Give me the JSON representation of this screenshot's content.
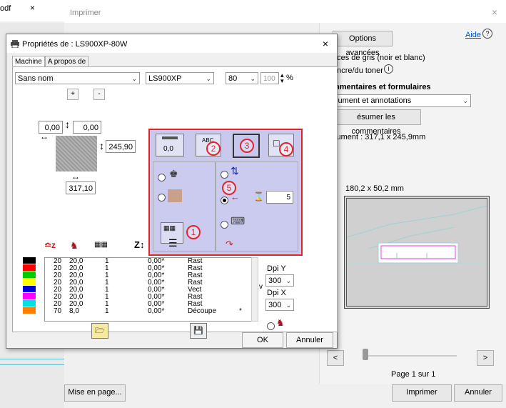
{
  "bg_dialog": {
    "tab_label": "odf",
    "tab_close": "×",
    "title": "Imprimer",
    "close": "×",
    "options_button": "Options avancées",
    "help_link": "Aide",
    "help_icon": "?",
    "grayscale_text": "nces de gris (noir et blanc)",
    "ink_text": "encre/du toner",
    "info_icon": "i",
    "comments_heading": "mmentaires et formulaires",
    "comments_select": "cument et annotations",
    "summarize_button": "ésumer les commentaires",
    "document_size": "cument : 317,1 x 245,9mm",
    "preview_size": "180,2 x 50,2 mm",
    "prev_button": "<",
    "next_button": ">",
    "page_label": "Page 1 sur 1",
    "layout_button": "Mise en page...",
    "print_button": "Imprimer",
    "cancel_button": "Annuler"
  },
  "props_dialog": {
    "title": "Propriétés de : LS900XP-80W",
    "close": "×",
    "tabs": [
      "Machine",
      "A propos de"
    ],
    "profile_select": "Sans nom",
    "model_select": "LS900XP",
    "power_select": "80",
    "percent_value": "100",
    "percent_unit": "%",
    "plus": "+",
    "minus": "-",
    "offset_x": "0,00",
    "offset_y": "0,00",
    "height": "245,90",
    "width": "317,10",
    "top_value": "0,0",
    "passes_value": "5",
    "badges": [
      "1",
      "2",
      "3",
      "4",
      "5"
    ],
    "table_rows": [
      {
        "color": "#000000",
        "power": "20",
        "speed": "20,0",
        "passes": "1",
        "z": "0,00*",
        "mode": "Rast",
        "mark": ""
      },
      {
        "color": "#ff0000",
        "power": "20",
        "speed": "20,0",
        "passes": "1",
        "z": "0,00*",
        "mode": "Rast",
        "mark": ""
      },
      {
        "color": "#00cc00",
        "power": "20",
        "speed": "20,0",
        "passes": "1",
        "z": "0,00*",
        "mode": "Rast",
        "mark": ""
      },
      {
        "color": "#ffff00",
        "power": "20",
        "speed": "20,0",
        "passes": "1",
        "z": "0,00*",
        "mode": "Rast",
        "mark": ""
      },
      {
        "color": "#0000dd",
        "power": "20",
        "speed": "20,0",
        "passes": "1",
        "z": "0,00*",
        "mode": "Vect",
        "mark": ""
      },
      {
        "color": "#ff00ff",
        "power": "20",
        "speed": "20,0",
        "passes": "1",
        "z": "0,00*",
        "mode": "Rast",
        "mark": ""
      },
      {
        "color": "#00e0e0",
        "power": "20",
        "speed": "20,0",
        "passes": "1",
        "z": "0,00*",
        "mode": "Rast",
        "mark": ""
      },
      {
        "color": "#ff8000",
        "power": "70",
        "speed": "8,0",
        "passes": "1",
        "z": "0,00*",
        "mode": "Découpe",
        "mark": "*"
      }
    ],
    "v_label": "v",
    "dpi_y_label": "Dpi Y",
    "dpi_y": "300",
    "dpi_x_label": "Dpi X",
    "dpi_x": "300",
    "ok_button": "OK",
    "cancel_button": "Annuler"
  }
}
